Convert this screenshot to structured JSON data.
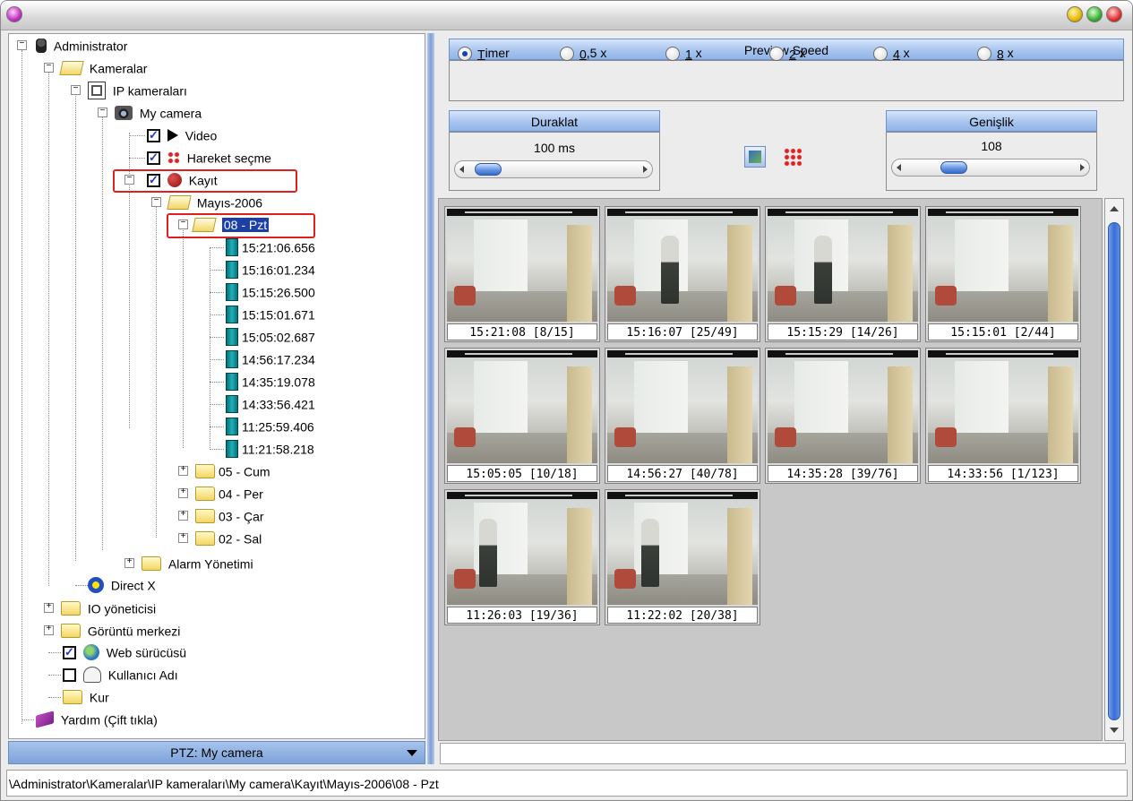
{
  "window": {
    "title": ""
  },
  "tree": {
    "root": "Administrator",
    "kameralar": "Kameralar",
    "ip_kameralari": "IP kameraları",
    "my_camera": "My camera",
    "video": "Video",
    "hareket": "Hareket seçme",
    "kayit": "Kayıt",
    "mayis": "Mayıs-2006",
    "day_selected": "08 - Pzt",
    "recordings": [
      "15:21:06.656",
      "15:16:01.234",
      "15:15:26.500",
      "15:15:01.671",
      "15:05:02.687",
      "14:56:17.234",
      "14:35:19.078",
      "14:33:56.421",
      "11:25:59.406",
      "11:21:58.218"
    ],
    "days": [
      "05 - Cum",
      "04 - Per",
      "03 - Çar",
      "02 - Sal"
    ],
    "alarm": "Alarm Yönetimi",
    "directx": "Direct X",
    "io": "IO yöneticisi",
    "goruntu": "Görüntü merkezi",
    "web": "Web sürücüsü",
    "kullanici": "Kullanıcı Adı",
    "kur": "Kur",
    "yardim": "Yardım (Çift tıkla)"
  },
  "ptz": {
    "label": "PTZ: My camera"
  },
  "preview_speed": {
    "title": "Preview Speed",
    "options": [
      {
        "key": "T",
        "rest": "imer",
        "suffix": ""
      },
      {
        "key": "0",
        "rest": ",5",
        "suffix": " x"
      },
      {
        "key": "1",
        "rest": "",
        "suffix": " x"
      },
      {
        "key": "2",
        "rest": "",
        "suffix": " x"
      },
      {
        "key": "4",
        "rest": "",
        "suffix": " x"
      },
      {
        "key": "8",
        "rest": "",
        "suffix": " x"
      }
    ],
    "selected": "Timer"
  },
  "duraklat": {
    "title": "Duraklat",
    "value": "100 ms"
  },
  "genislik": {
    "title": "Genişlik",
    "value": "108"
  },
  "thumbnails": [
    {
      "caption": "15:21:08 [8/15]"
    },
    {
      "caption": "15:16:07 [25/49]"
    },
    {
      "caption": "15:15:29 [14/26]"
    },
    {
      "caption": "15:15:01 [2/44]"
    },
    {
      "caption": "15:05:05 [10/18]"
    },
    {
      "caption": "14:56:27 [40/78]"
    },
    {
      "caption": "14:35:28 [39/76]"
    },
    {
      "caption": "14:33:56 [1/123]"
    },
    {
      "caption": "11:26:03 [19/36]"
    },
    {
      "caption": "11:22:02 [20/38]"
    }
  ],
  "status": {
    "path": "\\Administrator\\Kameralar\\IP kameraları\\My camera\\Kayıt\\Mayıs-2006\\08 - Pzt"
  }
}
